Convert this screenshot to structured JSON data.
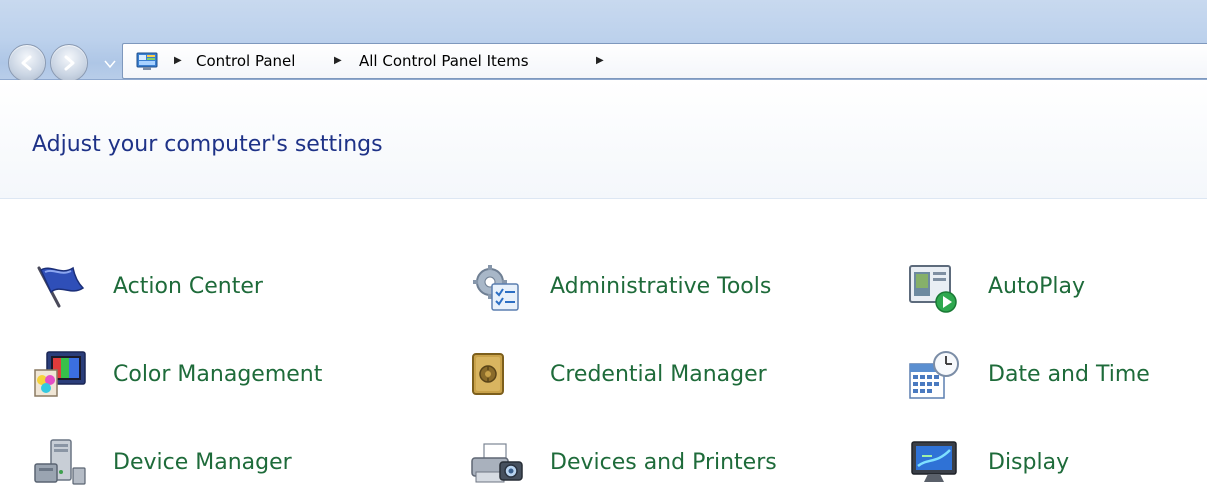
{
  "navigation": {
    "breadcrumbs": [
      "Control Panel",
      "All Control Panel Items"
    ]
  },
  "header": {
    "title": "Adjust your computer's settings"
  },
  "items": [
    {
      "label": "Action Center",
      "icon": "flag-icon"
    },
    {
      "label": "Administrative Tools",
      "icon": "admin-tools-icon"
    },
    {
      "label": "AutoPlay",
      "icon": "autoplay-icon"
    },
    {
      "label": "Color Management",
      "icon": "color-management-icon"
    },
    {
      "label": "Credential Manager",
      "icon": "vault-icon"
    },
    {
      "label": "Date and Time",
      "icon": "calendar-clock-icon"
    },
    {
      "label": "Device Manager",
      "icon": "device-manager-icon"
    },
    {
      "label": "Devices and Printers",
      "icon": "printer-camera-icon"
    },
    {
      "label": "Display",
      "icon": "monitor-icon"
    }
  ]
}
